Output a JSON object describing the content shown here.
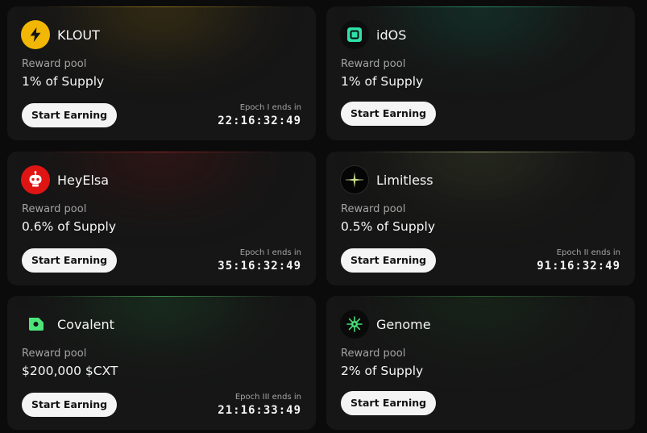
{
  "pool_label": "Reward pool",
  "cta_label": "Start Earning",
  "cards": [
    {
      "name": "KLOUT",
      "pool": "1% of Supply",
      "epoch_label": "Epoch I ends in",
      "epoch_time": "22:16:32:49",
      "icon": "lightning-bolt-icon",
      "accent": "#f2b705"
    },
    {
      "name": "idOS",
      "pool": "1% of Supply",
      "icon": "idos-square-icon",
      "accent": "#2fe0a8"
    },
    {
      "name": "HeyElsa",
      "pool": "0.6% of Supply",
      "epoch_label": "Epoch I ends in",
      "epoch_time": "35:16:32:49",
      "icon": "robot-face-icon",
      "accent": "#e11414"
    },
    {
      "name": "Limitless",
      "pool": "0.5% of Supply",
      "epoch_label": "Epoch II ends in",
      "epoch_time": "91:16:32:49",
      "icon": "sparkle-star-icon",
      "accent": "#c7d98a"
    },
    {
      "name": "Covalent",
      "pool": "$200,000 $CXT",
      "epoch_label": "Epoch III ends in",
      "epoch_time": "21:16:33:49",
      "icon": "covalent-shape-icon",
      "accent": "#4ce67a"
    },
    {
      "name": "Genome",
      "pool": "2% of Supply",
      "icon": "genome-burst-icon",
      "accent": "#48e07a"
    }
  ]
}
